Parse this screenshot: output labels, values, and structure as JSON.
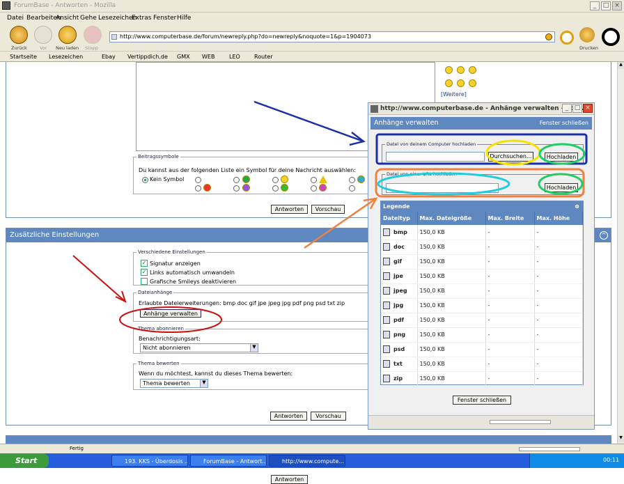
{
  "window": {
    "title": "ForumBase - Antworten - Mozilla"
  },
  "menu": [
    "Datei",
    "Bearbeiten",
    "Ansicht",
    "Gehe",
    "Lesezeichen",
    "Extras",
    "Fenster",
    "Hilfe"
  ],
  "nav": {
    "back": "Zurück",
    "forward": "Vor",
    "reload": "Neu laden",
    "stop": "Stopp",
    "print": "Drucken",
    "url": "http://www.computerbase.de/forum/newreply.php?do=newreply&noquote=1&p=1904073"
  },
  "bookmarks": [
    "Startseite",
    "Lesezeichen",
    "Ebay",
    "Vertippdich.de",
    "GMX",
    "WEB",
    "LEO",
    "Router"
  ],
  "smiley_more": "[Weitere]",
  "post_icons": {
    "legend": "Beitragssymbole",
    "text": "Du kannst aus der folgenden Liste ein Symbol für deine Nachricht auswählen:",
    "none": "Kein Symbol"
  },
  "buttons": {
    "reply": "Antworten",
    "preview": "Vorschau"
  },
  "extra": {
    "title": "Zusätzliche Einstellungen",
    "misc_legend": "Verschiedene Einstellungen",
    "opt1": "Signatur anzeigen",
    "opt2": "Links automatisch umwandeln",
    "opt3": "Grafische Smileys deaktivieren",
    "attach_legend": "Dateianhänge",
    "allowed": "Erlaubte Dateierweiterungen: bmp doc gif jpe jpeg jpg pdf png psd txt zip",
    "manage": "Anhänge verwalten",
    "sub_legend": "Thema abonnieren",
    "notify_label": "Benachrichtigungsart:",
    "notify_value": "Nicht abonnieren",
    "rate_legend": "Thema bewerten",
    "rate_text": "Wenn du möchtest, kannst du dieses Thema bewerten:",
    "rate_value": "Thema bewerten"
  },
  "popup": {
    "title": "http://www.computerbase.de - Anhänge verwalten - For...",
    "header": "Anhänge verwalten",
    "close_link": "Fenster schließen",
    "upload_local": "Datei von deinem Computer hochladen",
    "browse": "Durchsuchen...",
    "upload": "Hochladen",
    "upload_url": "Datei von einer URL hochladen",
    "legend_title": "Legende",
    "columns": [
      "Dateityp",
      "Max. Dateigröße",
      "Max. Breite",
      "Max. Höhe"
    ],
    "rows": [
      {
        "type": "bmp",
        "size": "150,0 KB",
        "w": "-",
        "h": "-"
      },
      {
        "type": "doc",
        "size": "150,0 KB",
        "w": "-",
        "h": "-"
      },
      {
        "type": "gif",
        "size": "150,0 KB",
        "w": "-",
        "h": "-"
      },
      {
        "type": "jpe",
        "size": "150,0 KB",
        "w": "-",
        "h": "-"
      },
      {
        "type": "jpeg",
        "size": "150,0 KB",
        "w": "-",
        "h": "-"
      },
      {
        "type": "jpg",
        "size": "150,0 KB",
        "w": "-",
        "h": "-"
      },
      {
        "type": "pdf",
        "size": "150,0 KB",
        "w": "-",
        "h": "-"
      },
      {
        "type": "png",
        "size": "150,0 KB",
        "w": "-",
        "h": "-"
      },
      {
        "type": "psd",
        "size": "150,0 KB",
        "w": "-",
        "h": "-"
      },
      {
        "type": "txt",
        "size": "150,0 KB",
        "w": "-",
        "h": "-"
      },
      {
        "type": "zip",
        "size": "150,0 KB",
        "w": "-",
        "h": "-"
      }
    ],
    "close_button": "Fenster schließen"
  },
  "status": {
    "text": "Fertig"
  },
  "taskbar": {
    "start": "Start",
    "tasks": [
      "193. KKS - Überdosis ...",
      "ForumBase - Antwort...",
      "http://www.compute..."
    ],
    "clock": "00:11"
  },
  "colors": {
    "panel_head": "#5F88C0",
    "arrow_blue": "#1A2FA8",
    "arrow_red": "#CC1111",
    "arrow_orange": "#F08040",
    "circle_yellow": "#F5E400",
    "circle_green": "#22CC66",
    "circle_cyan": "#22CCDD"
  }
}
